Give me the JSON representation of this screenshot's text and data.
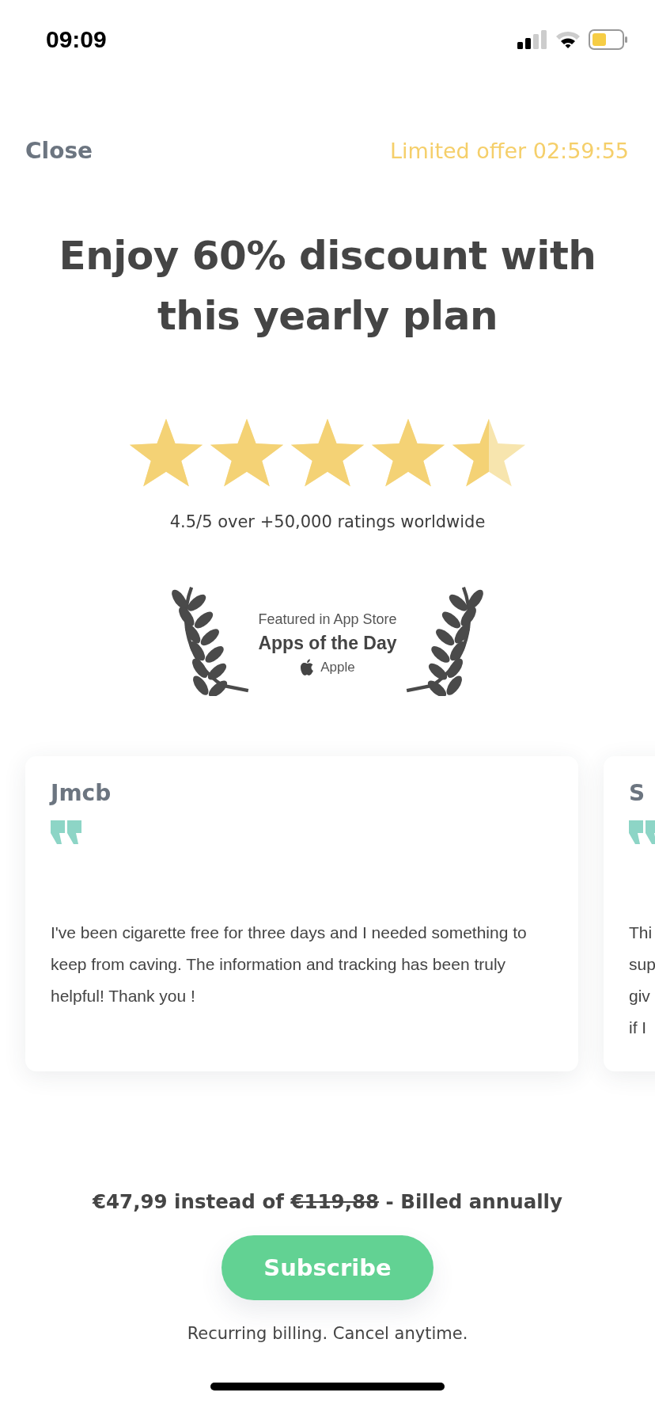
{
  "status_bar": {
    "time": "09:09"
  },
  "header": {
    "close": "Close",
    "offer": "Limited offer 02:59:55"
  },
  "title": "Enjoy **60% discount** with this yearly plan",
  "rating": {
    "stars": 4.5,
    "caption": "4.5/5 over +50,000 ratings worldwide"
  },
  "badge": {
    "featured": "Featured in App Store",
    "award": "Apps of the Day",
    "brand": "Apple"
  },
  "reviews": [
    {
      "author": "Jmcb",
      "lines": [
        "I've been cigarette free for three days and I needed something to keep from caving. The information and tracking has been truly helpful! Thank you !"
      ]
    },
    {
      "author": "S",
      "lines": [
        "Thi",
        "sup",
        "giv",
        "if I"
      ]
    }
  ],
  "pricing": {
    "price": "€47,99",
    "connector": "instead of",
    "old_price": "€119,88",
    "suffix": "- Billed annually"
  },
  "subscribe": "Subscribe",
  "note": "Recurring billing. Cancel anytime."
}
